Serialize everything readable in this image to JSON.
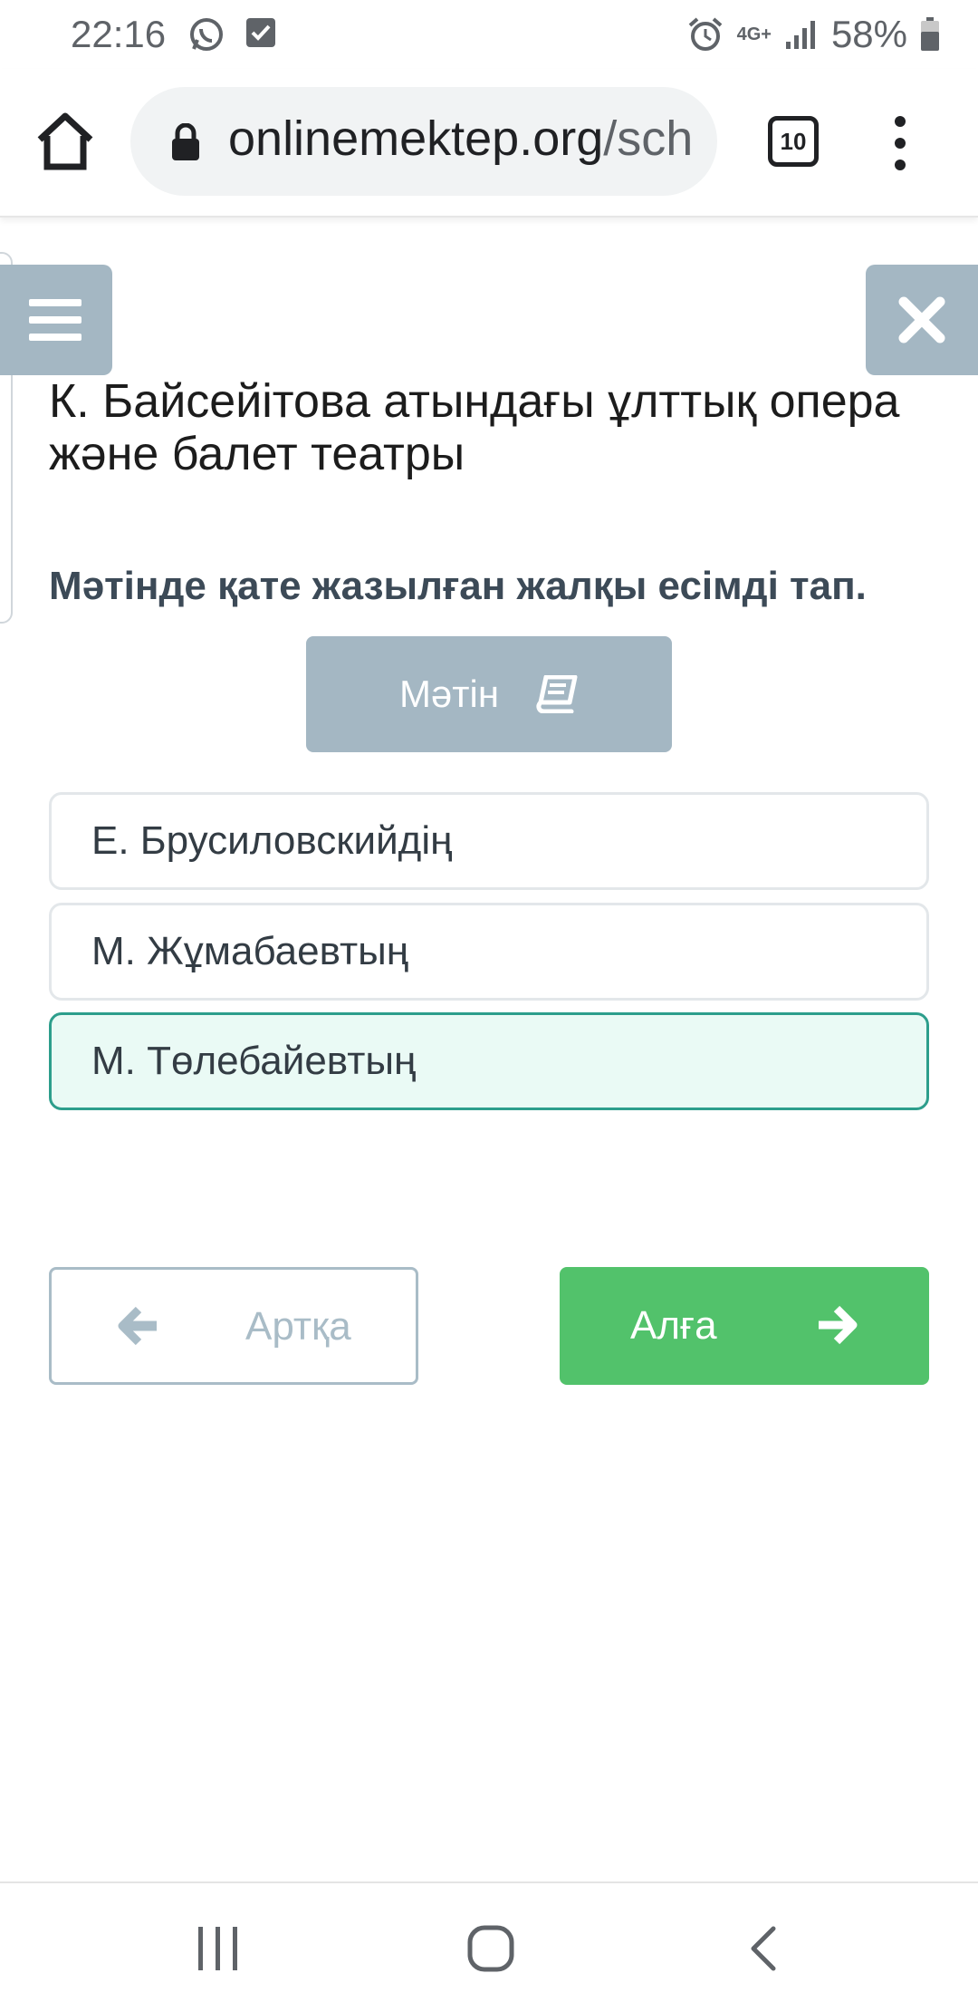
{
  "status_bar": {
    "time": "22:16",
    "network": "4G+",
    "battery": "58%",
    "icons": [
      "whatsapp-icon",
      "checkbox-notification-icon",
      "alarm-icon",
      "signal-icon",
      "battery-icon"
    ]
  },
  "browser": {
    "url_domain": "onlinemektep.org",
    "url_path": "/sch",
    "tab_count": "10"
  },
  "page": {
    "title": "К. Байсейітова атындағы ұлттық опера және балет театры",
    "question": "Мәтінде қате жазылған жалқы есімді тап.",
    "text_button_label": "Мәтін",
    "options": [
      {
        "label": "Е. Брусиловскийдің",
        "selected": false
      },
      {
        "label": "М. Жұмабаевтың",
        "selected": false
      },
      {
        "label": "М. Төлебайевтың",
        "selected": true
      }
    ],
    "back_label": "Артқа",
    "next_label": "Алға"
  },
  "colors": {
    "accent_gray_blue": "#a4b7c3",
    "next_green": "#52c26b",
    "selected_border": "#2d9e8c",
    "selected_bg": "#eafaf5"
  }
}
